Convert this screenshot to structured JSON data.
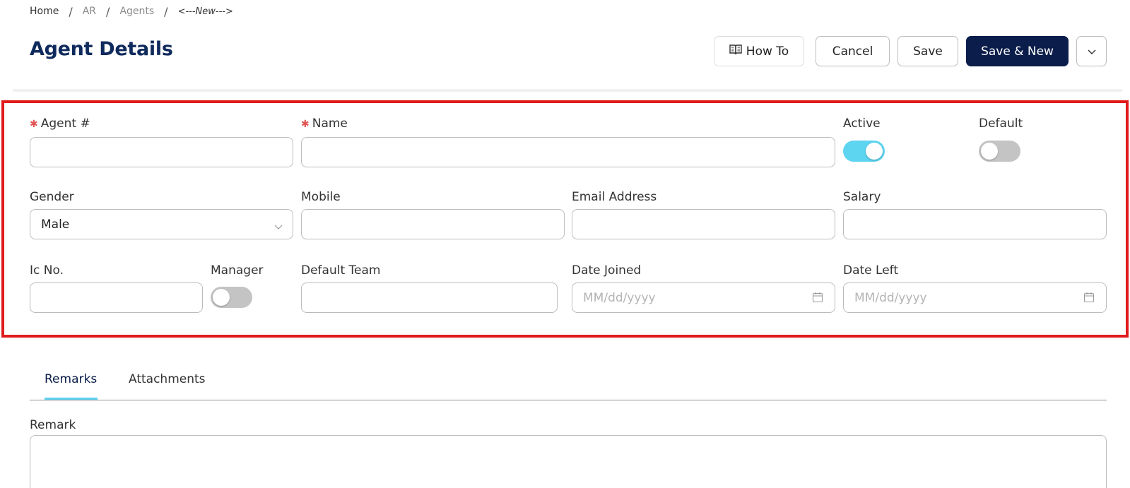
{
  "breadcrumb": {
    "home": "Home",
    "module": "AR",
    "section": "Agents",
    "current": "<---New--->",
    "separator": "/"
  },
  "page": {
    "title": "Agent Details"
  },
  "toolbar": {
    "howto_label": "How To",
    "howto_icon": "book-icon",
    "cancel_label": "Cancel",
    "save_label": "Save",
    "save_new_label": "Save & New",
    "more_icon": "chevron-down-icon"
  },
  "form": {
    "agent_no": {
      "label": "Agent #",
      "required": true,
      "value": ""
    },
    "name": {
      "label": "Name",
      "required": true,
      "value": ""
    },
    "active": {
      "label": "Active",
      "on": true
    },
    "default": {
      "label": "Default",
      "on": false
    },
    "gender": {
      "label": "Gender",
      "value": "Male"
    },
    "mobile": {
      "label": "Mobile",
      "value": ""
    },
    "email": {
      "label": "Email Address",
      "value": ""
    },
    "salary": {
      "label": "Salary",
      "value": ""
    },
    "ic_no": {
      "label": "Ic No.",
      "value": ""
    },
    "manager": {
      "label": "Manager",
      "on": false
    },
    "default_team": {
      "label": "Default Team",
      "value": ""
    },
    "date_joined": {
      "label": "Date Joined",
      "placeholder": "MM/dd/yyyy"
    },
    "date_left": {
      "label": "Date Left",
      "placeholder": "MM/dd/yyyy"
    }
  },
  "tabs": [
    {
      "label": "Remarks",
      "active": true
    },
    {
      "label": "Attachments",
      "active": false
    }
  ],
  "remark": {
    "label": "Remark",
    "value": ""
  },
  "colors": {
    "brand_navy": "#0b1d4a",
    "title_navy": "#0f2a5c",
    "toggle_on": "#5dd4f0",
    "highlight_red": "#e01b1b",
    "required_red": "#e05555"
  }
}
